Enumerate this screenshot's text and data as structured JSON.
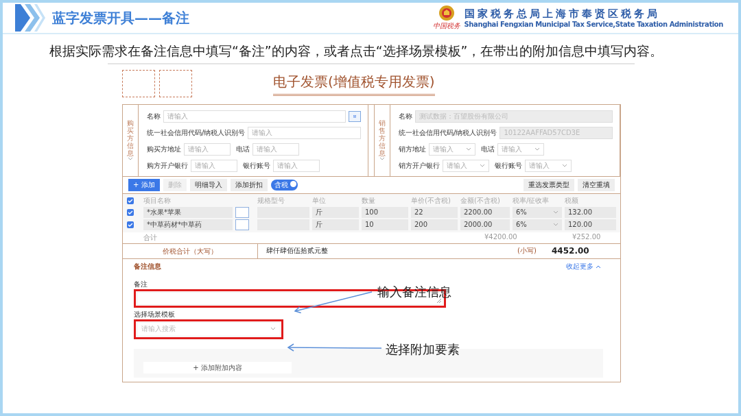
{
  "slide": {
    "title": "蓝字发票开具——备注",
    "org_mark": "中国税务",
    "org_cn": "国家税务总局上海市奉贤区税务局",
    "org_en": "Shanghai Fengxian Municipal Tax Service,State Taxation Administration"
  },
  "intro": "根据实际需求在备注信息中填写“备注”的内容，或者点击“选择场景模板”，在带出的附加信息中填写内容。",
  "invoice": {
    "title": "电子发票(增值税专用发票)",
    "parties": [
      {
        "label": "购买方信息",
        "rows": [
          [
            {
              "label": "名称",
              "kind": "picker",
              "placeholder": "请输入"
            }
          ],
          [
            {
              "label": "统一社会信用代码/纳税人识别号",
              "kind": "input",
              "placeholder": "请输入"
            }
          ],
          [
            {
              "label": "购买方地址",
              "kind": "input",
              "placeholder": "请输入"
            },
            {
              "label": "电话",
              "kind": "input",
              "placeholder": "请输入"
            }
          ],
          [
            {
              "label": "购方开户银行",
              "kind": "input",
              "placeholder": "请输入"
            },
            {
              "label": "银行账号",
              "kind": "input",
              "placeholder": "请输入"
            }
          ]
        ]
      },
      {
        "label": "销售方信息",
        "rows": [
          [
            {
              "label": "名称",
              "kind": "readonly",
              "value": "测试数据：百望股份有限公司"
            }
          ],
          [
            {
              "label": "统一社会信用代码/纳税人识别号",
              "kind": "readonly",
              "value": "10122AAFFAD57CD3E"
            }
          ],
          [
            {
              "label": "销方地址",
              "kind": "select",
              "placeholder": "请输入"
            },
            {
              "label": "电话",
              "kind": "select",
              "placeholder": "请输入"
            }
          ],
          [
            {
              "label": "销方开户银行",
              "kind": "select",
              "placeholder": "请输入"
            },
            {
              "label": "银行账号",
              "kind": "select",
              "placeholder": "请输入"
            }
          ]
        ]
      }
    ],
    "toolbar": [
      {
        "label": "+ 添加",
        "kind": "primary",
        "disabled": false
      },
      {
        "label": "删除",
        "kind": "plain",
        "disabled": true
      },
      {
        "label": "明细导入",
        "kind": "plain",
        "disabled": false
      },
      {
        "label": "添加折扣",
        "kind": "plain",
        "disabled": false
      }
    ],
    "tax_toggle": {
      "label": "含税",
      "on": true
    },
    "toolbar_right": [
      "重选发票类型",
      "清空重填"
    ],
    "table": {
      "all_checked": true,
      "columns": [
        "项目名称",
        "规格型号",
        "单位",
        "数量",
        "单价(不含税)",
        "金额(不含税)",
        "税率/征收率",
        "税额"
      ],
      "rows": [
        {
          "checked": true,
          "cells": [
            "*水果*苹果",
            "",
            "斤",
            "100",
            "22",
            "2200.00",
            "6%",
            "132.00"
          ]
        },
        {
          "checked": true,
          "cells": [
            "*中草药材*中草药",
            "",
            "斤",
            "10",
            "200",
            "2000.00",
            "6%",
            "120.00"
          ]
        }
      ],
      "total_label": "合计",
      "total_amount": "¥4200.00",
      "total_tax": "¥252.00"
    },
    "summary": {
      "label": "价税合计（大写）",
      "words": "肆仟肆佰伍拾贰元整",
      "small_label": "(小写)",
      "figure": "4452.00"
    },
    "remarks": {
      "title": "备注信息",
      "collapse": "收起更多",
      "note_label": "备注",
      "template_label": "选择场景模板",
      "template_placeholder": "请输入搜索",
      "add_button": "+ 添加附加内容"
    }
  },
  "callouts": [
    {
      "text": "输入备注信息"
    },
    {
      "text": "选择附加要素"
    }
  ]
}
